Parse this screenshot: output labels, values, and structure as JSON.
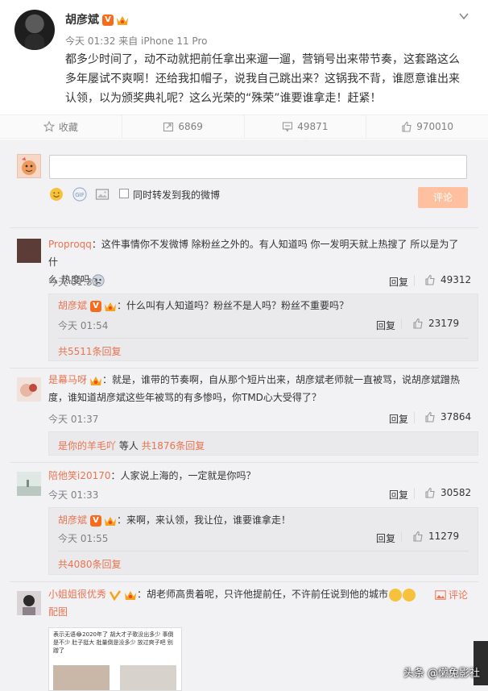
{
  "post": {
    "author": "胡彦斌",
    "verified_badge": "V",
    "meta": "今天 01:32 来自 iPhone 11 Pro",
    "text_lines": [
      "都多少时间了，动不动就把前任拿出来遛一遛，营销号出来带节奏，这套路这么",
      "多年屡试不爽啊！还给我扣帽子，说我自己跳出来？这锅我不背，谁愿意谁出来",
      "认领，以为颁奖典礼呢？这么光荣的“殊荣”谁要谁拿走！赶紧！"
    ]
  },
  "actions": {
    "favorite": "收藏",
    "repost": "6869",
    "comment": "49871",
    "like": "970010"
  },
  "composer": {
    "sync_label": "同时转发到我的微博",
    "submit": "评论"
  },
  "comments": [
    {
      "user": "Proproqq",
      "text_line1": "：这件事情你不发微博 除粉丝之外的。有人知道吗 你一发明天就上热搜了 所以是为了什",
      "text_line2": "么 热度吗",
      "time": "今天 01:33",
      "reply": "回复",
      "likes": "49312",
      "sub": {
        "user": "胡彦斌",
        "text": "：什么叫有人知道吗？粉丝不是人吗？粉丝不重要吗？",
        "time": "今天 01:54",
        "reply": "回复",
        "likes": "23179"
      },
      "more": "共5511条回复"
    },
    {
      "user": "是幕马呀",
      "text_line1": "：就是，谁带的节奏啊，自从那个短片出来，胡彦斌老师就一直被骂，说胡彦斌蹭热",
      "text_line2": "度，谁知道胡彦斌这些年被骂的有多惨吗，你TMD心大受得了？",
      "time": "今天 01:37",
      "reply": "回复",
      "likes": "37864",
      "more_user": "是你的羊毛吖",
      "more_mid": " 等人 ",
      "more": "共1876条回复"
    },
    {
      "user": "陪他笑i20170",
      "text_line1": "：人家说上海的，一定就是你吗？",
      "time": "今天 01:33",
      "reply": "回复",
      "likes": "30582",
      "sub": {
        "user": "胡彦斌",
        "text": "：来啊，来认领，我让位，谁要谁拿走！",
        "time": "今天 01:55",
        "reply": "回复",
        "likes": "11279"
      },
      "more": "共4080条回复"
    },
    {
      "user": "小姐姐很优秀",
      "text_line1": "：胡老师高贵着呢，只许他提前任，不许前任说到他的城市",
      "comment_link": "评论",
      "pic_link": "配图",
      "thumb_text": "表示无语😂2020年了 胡大才子歌没出多少 事倒是不少 肚子挺大 批量倒是没多少 放过爽子吧 别蹭了"
    }
  ],
  "watermark": "头条 @懒兔影社",
  "colors": {
    "link": "#eb7350",
    "badge": "#f76b1c",
    "submit_bg": "#ffc09f",
    "panel_bg": "#f2f2f5"
  }
}
